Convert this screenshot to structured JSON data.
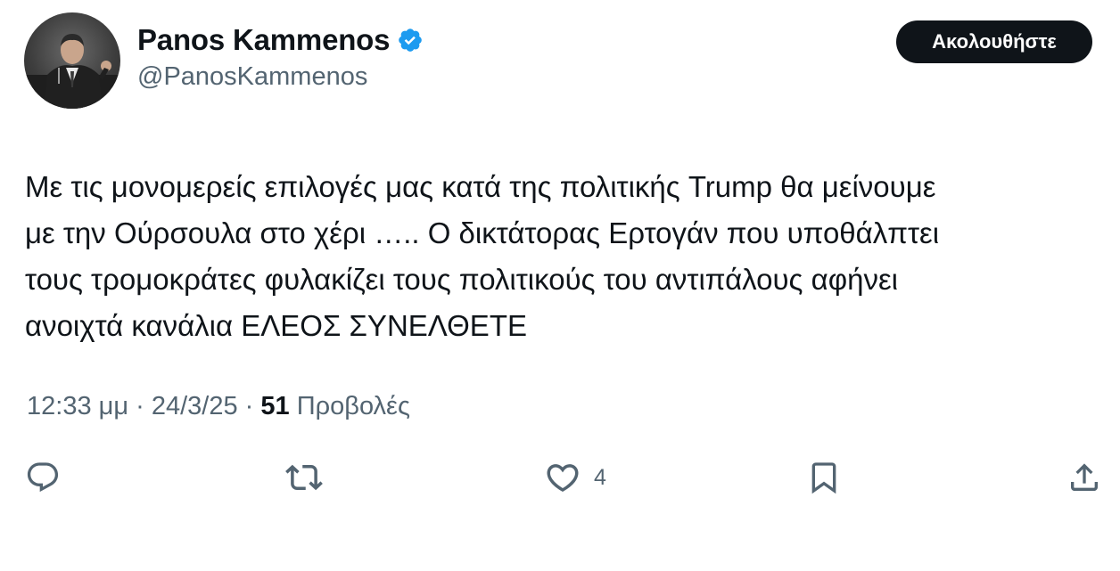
{
  "author": {
    "display_name": "Panos Kammenos",
    "handle": "@PanosKammenos",
    "verified": true,
    "avatar_icon": "profile-photo"
  },
  "follow_button": {
    "label": "Ακολουθήστε"
  },
  "tweet": {
    "text_lines": [
      "Με τις μονομερείς επιλογές μας κατά της πολιτικής Trump θα μείνουμε",
      "με την Ούρσουλα στο χέρι ….. Ο δικτάτορας Ερτογάν που υποθάλπτει",
      "τους τρομοκράτες φυλακίζει τους πολιτικούς του αντιπάλους αφήνει",
      "ανοιχτά κανάλια ΕΛΕΟΣ ΣΥΝΕΛΘΕΤΕ"
    ],
    "time": "12:33 μμ",
    "date": "24/3/25",
    "separator": " · ",
    "views_count": "51",
    "views_label": "Προβολές"
  },
  "actions": {
    "reply_icon": "reply-icon",
    "retweet_icon": "retweet-icon",
    "like_icon": "heart-icon",
    "like_count": "4",
    "bookmark_icon": "bookmark-icon",
    "share_icon": "share-icon"
  },
  "colors": {
    "text_primary": "#0f1419",
    "text_secondary": "#536471",
    "verified_blue": "#1d9bf0",
    "button_bg": "#0f1419",
    "button_text": "#ffffff"
  }
}
